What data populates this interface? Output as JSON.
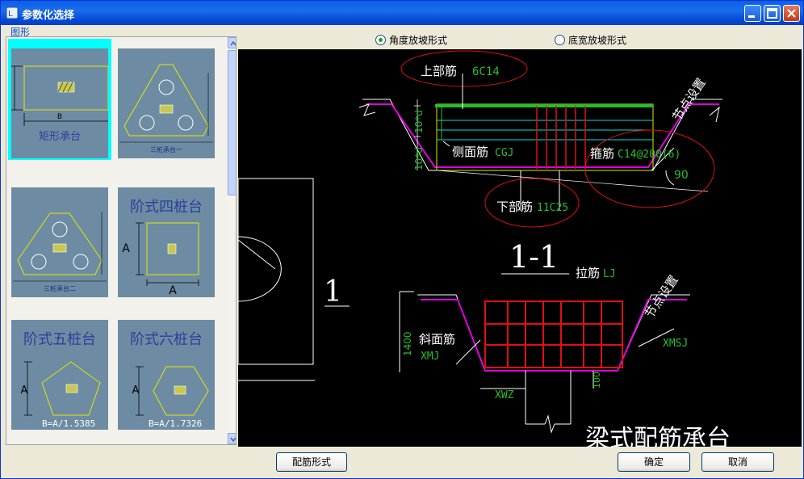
{
  "window": {
    "title": "参数化选择"
  },
  "group": {
    "label": "图形"
  },
  "tiles": [
    {
      "label": "矩形承台",
      "dim_b": "B"
    },
    {
      "label": "三桩承台一"
    },
    {
      "label": "三桩承台二"
    },
    {
      "label": "阶式四桩台",
      "dim_a1": "A",
      "dim_a2": "A"
    },
    {
      "label": "阶式五桩台",
      "dim_a": "A",
      "formula": "B=A/1.5385"
    },
    {
      "label": "阶式六桩台",
      "dim_a": "A",
      "formula": "B=A/1.7326"
    }
  ],
  "options": {
    "angle_slope": "角度放坡形式",
    "width_slope": "底宽放坡形式",
    "selected": "angle_slope"
  },
  "drawing": {
    "section_mark": "1",
    "section_title": "1-1",
    "top_bar_label": "上部筋",
    "top_bar_value": "6C14",
    "side_bar_label": "侧面筋",
    "side_bar_value": "CGJ",
    "stirrup_label": "箍筋",
    "stirrup_value": "C14@200(6)",
    "bottom_bar_label": "下部筋",
    "bottom_bar_value": "11C25",
    "angle": "90",
    "node_setting": "节点设置",
    "node_setting2": "节点设置",
    "dim_10d_a": "10*d",
    "dim_10d_b": "10*d",
    "tie_label": "拉筋",
    "tie_value": "LJ",
    "slope_bar_label": "斜面筋",
    "slope_bar_value": "XMJ",
    "xmsj": "XMSJ",
    "xwz": "XWZ",
    "dim_1400": "1400",
    "dim_100": "100",
    "bottom_title": "梁式配筋承台"
  },
  "buttons": {
    "rebar_form": "配筋形式",
    "ok": "确定",
    "cancel": "取消"
  },
  "colors": {
    "cad_background": "#000000",
    "cad_green": "#22C02A",
    "cad_magenta": "#E000E0",
    "cad_red": "#E01010",
    "cad_yellow": "#E6E600",
    "cad_cyan": "#00E0E0"
  }
}
